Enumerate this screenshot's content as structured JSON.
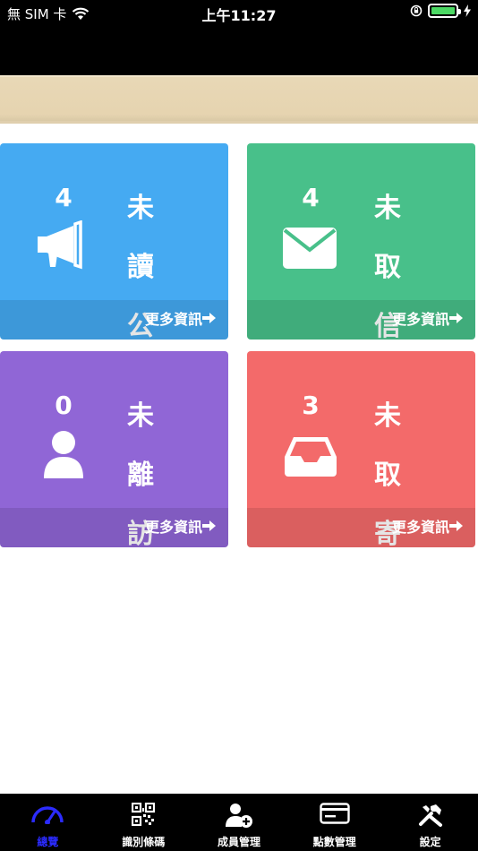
{
  "status_bar": {
    "carrier": "無 SIM 卡",
    "time": "上午11:27"
  },
  "cards": [
    {
      "count": "4",
      "title": "未讀公告",
      "more": "更多資訊",
      "icon": "megaphone-icon",
      "color": "#45aaf2"
    },
    {
      "count": "4",
      "title": "未取信件",
      "more": "更多資訊",
      "icon": "envelope-icon",
      "color": "#48c08a"
    },
    {
      "count": "0",
      "title": "未離訪客",
      "more": "更多資訊",
      "icon": "person-icon",
      "color": "#9066d6"
    },
    {
      "count": "3",
      "title": "未取寄物",
      "more": "更多資訊",
      "icon": "inbox-tray-icon",
      "color": "#f36a6a"
    }
  ],
  "tabs": [
    {
      "label": "總覽",
      "icon": "dashboard-gauge-icon",
      "active": true
    },
    {
      "label": "識別條碼",
      "icon": "qr-code-icon"
    },
    {
      "label": "成員管理",
      "icon": "add-user-icon"
    },
    {
      "label": "點數管理",
      "icon": "credit-card-icon"
    },
    {
      "label": "設定",
      "icon": "tools-icon"
    }
  ],
  "colors": {
    "active_tab": "#2b2bff",
    "banner": "#e6d4b0"
  }
}
